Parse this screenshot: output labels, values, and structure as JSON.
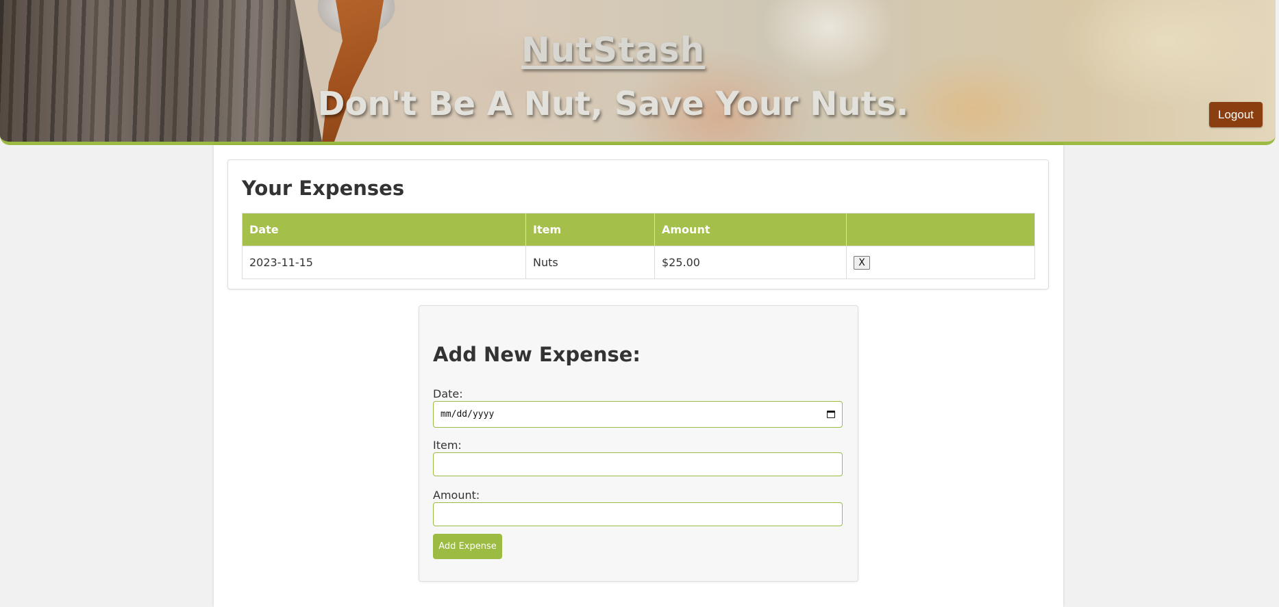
{
  "header": {
    "brand": "NutStash",
    "tagline": "Don't Be A Nut, Save Your Nuts.",
    "logout_label": "Logout"
  },
  "expenses": {
    "title": "Your Expenses",
    "columns": [
      "Date",
      "Item",
      "Amount",
      ""
    ],
    "rows": [
      {
        "date": "2023-11-15",
        "item": "Nuts",
        "amount": "$25.00",
        "delete_label": "X"
      }
    ]
  },
  "form": {
    "title": "Add New Expense:",
    "date_label": "Date:",
    "date_placeholder": "mm/dd/yyyy",
    "item_label": "Item:",
    "item_value": "",
    "amount_label": "Amount:",
    "amount_value": "",
    "submit_label": "Add Expense"
  },
  "colors": {
    "accent_green": "#a5bf4b",
    "logout_brown": "#8b3e0f"
  }
}
